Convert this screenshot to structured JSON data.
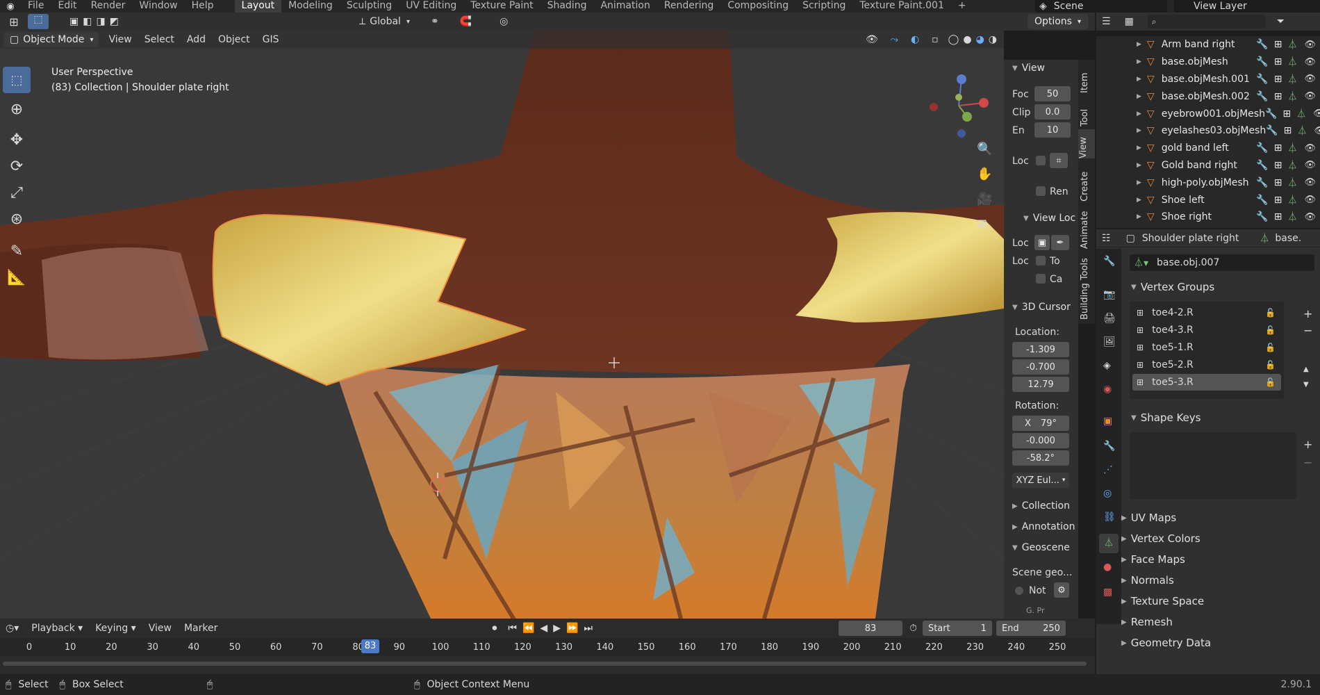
{
  "menu": {
    "items": [
      "File",
      "Edit",
      "Render",
      "Window",
      "Help"
    ],
    "workspaces": [
      "Layout",
      "Modeling",
      "Sculpting",
      "UV Editing",
      "Texture Paint",
      "Shading",
      "Animation",
      "Rendering",
      "Compositing",
      "Scripting",
      "Texture Paint.001"
    ],
    "active_workspace": "Layout",
    "add_tab": "+",
    "scene": "Scene",
    "view_layer": "View Layer"
  },
  "viewport_header": {
    "mode": "Object Mode",
    "menus": [
      "View",
      "Select",
      "Add",
      "Object",
      "GIS"
    ],
    "orientation": "Global",
    "options": "Options"
  },
  "viewport": {
    "perspective": "User Perspective",
    "context": "(83) Collection | Shoulder plate right"
  },
  "side_tabs": [
    "Item",
    "Tool",
    "View",
    "Create",
    "Animate",
    "Building Tools"
  ],
  "npanel": {
    "view_title": "View",
    "focal_label": "Foc",
    "focal_value": "50",
    "clip_label": "Clip",
    "clip_value": "0.0",
    "end_label": "En",
    "end_value": "10",
    "loc_label": "Loc",
    "ren_label": "Ren",
    "view_lock_title": "View Loc",
    "lock_loc_label": "Loc",
    "lock_loc2_label": "Loc",
    "to_label": "To",
    "ca_label": "Ca",
    "cursor_title": "3D Cursor",
    "location_label": "Location:",
    "loc_x": "-1.309",
    "loc_y": "-0.700",
    "loc_z": "12.79",
    "rotation_label": "Rotation:",
    "rot_x_label": "X",
    "rot_x": "79°",
    "rot_y": "-0.000",
    "rot_z": "-58.2°",
    "rot_mode": "XYZ Eul...",
    "collection_title": "Collection",
    "annotation_title": "Annotation",
    "geoscene_title": "Geoscene",
    "scene_geo": "Scene geo...",
    "not_label": "Not",
    "g_pr": "G. Pr"
  },
  "outliner": {
    "items": [
      {
        "name": "Arm band right"
      },
      {
        "name": "base.objMesh"
      },
      {
        "name": "base.objMesh.001"
      },
      {
        "name": "base.objMesh.002"
      },
      {
        "name": "eyebrow001.objMesh"
      },
      {
        "name": "eyelashes03.objMesh"
      },
      {
        "name": "gold band left"
      },
      {
        "name": "Gold band right"
      },
      {
        "name": "high-poly.objMesh"
      },
      {
        "name": "Shoe left"
      },
      {
        "name": "Shoe right"
      }
    ]
  },
  "properties": {
    "object_name": "Shoulder plate right",
    "mesh_short": "base.",
    "mesh_name": "base.obj.007",
    "vertex_groups_title": "Vertex Groups",
    "vertex_groups": [
      "toe4-2.R",
      "toe4-3.R",
      "toe5-1.R",
      "toe5-2.R",
      "toe5-3.R"
    ],
    "selected_group": "toe5-3.R",
    "shape_keys_title": "Shape Keys",
    "sections": [
      "UV Maps",
      "Vertex Colors",
      "Face Maps",
      "Normals",
      "Texture Space",
      "Remesh",
      "Geometry Data"
    ]
  },
  "timeline": {
    "menus": [
      "Playback",
      "Keying",
      "View",
      "Marker"
    ],
    "current_frame": "83",
    "start_label": "Start",
    "start_value": "1",
    "end_label": "End",
    "end_value": "250",
    "ticks": [
      "0",
      "10",
      "20",
      "30",
      "40",
      "50",
      "60",
      "70",
      "80",
      "90",
      "100",
      "110",
      "120",
      "130",
      "140",
      "150",
      "160",
      "170",
      "180",
      "190",
      "200",
      "210",
      "220",
      "230",
      "240",
      "250"
    ]
  },
  "statusbar": {
    "select": "Select",
    "box_select": "Box Select",
    "context_menu": "Object Context Menu",
    "version": "2.90.1"
  }
}
